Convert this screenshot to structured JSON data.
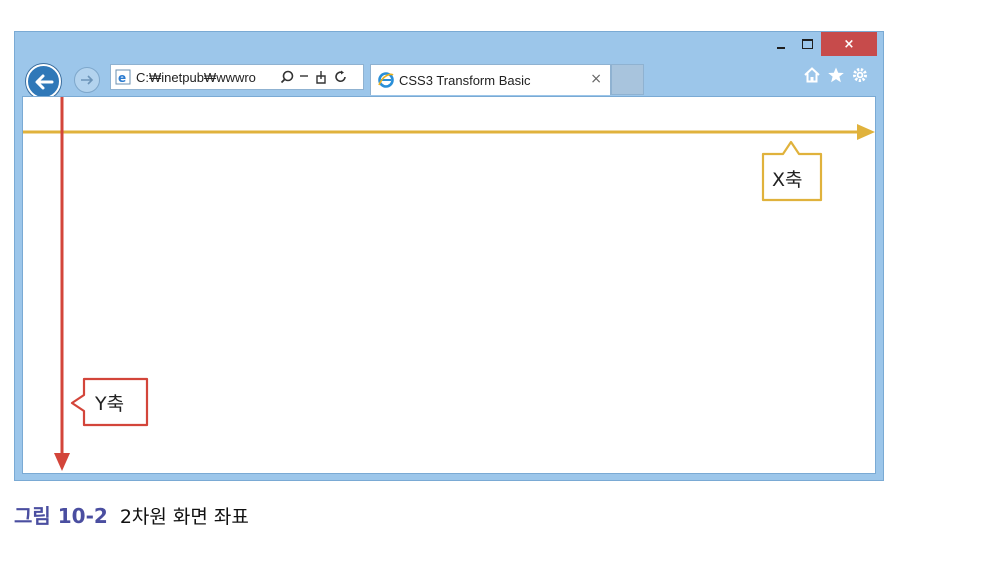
{
  "window": {
    "controls": {
      "minimize": "",
      "maximize": "",
      "close": "×"
    }
  },
  "toolbar": {
    "back_icon": "back-arrow-icon",
    "forward_icon": "forward-arrow-icon",
    "address": {
      "value": "C:₩inetpub₩wwwro",
      "tools": [
        "search-icon",
        "dropdown-icon",
        "compatibility-icon",
        "refresh-icon"
      ]
    },
    "tab": {
      "title": "CSS3 Transform Basic",
      "close": "×"
    },
    "right_icons": [
      "home-icon",
      "favorites-star-icon",
      "settings-gear-icon"
    ]
  },
  "axes": {
    "x_label": "X축",
    "y_label": "Y축",
    "x_color": "#e0b23c",
    "y_color": "#d3453a"
  },
  "caption": {
    "label": "그림 10-2",
    "text": "2차원 화면 좌표"
  }
}
